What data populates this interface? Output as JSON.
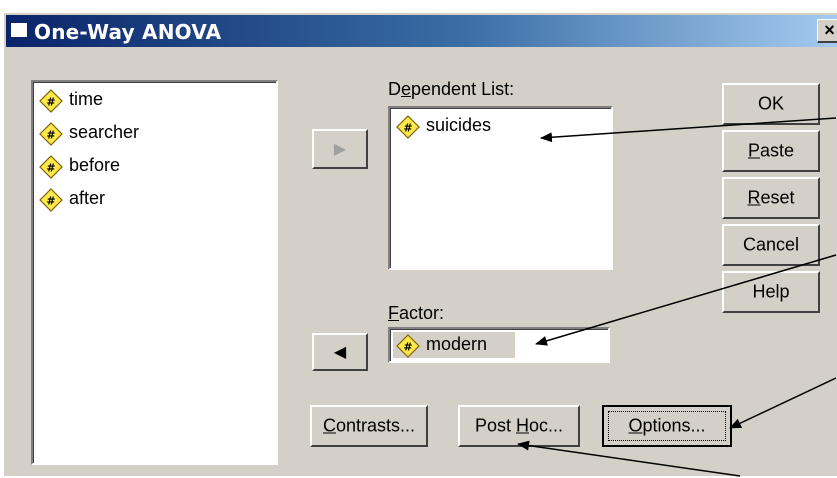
{
  "window": {
    "title": "One-Way ANOVA",
    "close_glyph": "×",
    "icon": "spss-dialog-icon"
  },
  "source_list": {
    "items": [
      {
        "label": "time",
        "icon": "scale-variable-icon"
      },
      {
        "label": "searcher",
        "icon": "scale-variable-icon"
      },
      {
        "label": "before",
        "icon": "scale-variable-icon"
      },
      {
        "label": "after",
        "icon": "scale-variable-icon"
      }
    ]
  },
  "dependent": {
    "label_prefix": "D",
    "label_underlined": "e",
    "label_suffix": "pendent List:",
    "items": [
      {
        "label": "suicides",
        "icon": "scale-variable-icon"
      }
    ]
  },
  "factor": {
    "label_underlined": "F",
    "label_suffix": "actor:",
    "value": "modern",
    "icon": "scale-variable-icon"
  },
  "transfer_buttons": {
    "dependent_arrow": "▶",
    "factor_arrow": "◀"
  },
  "side_buttons": {
    "ok": {
      "label": "OK"
    },
    "paste": {
      "underlined": "P",
      "rest": "aste"
    },
    "reset": {
      "underlined": "R",
      "rest": "eset"
    },
    "cancel": {
      "label": "Cancel"
    },
    "help": {
      "label": "Help"
    }
  },
  "bottom_buttons": {
    "contrasts": {
      "underlined": "C",
      "rest": "ontrasts..."
    },
    "posthoc": {
      "prefix": "Post ",
      "underlined": "H",
      "rest": "oc..."
    },
    "options": {
      "underlined": "O",
      "rest": "ptions..."
    }
  },
  "colors": {
    "titlebar_start": "#0a246a",
    "titlebar_end": "#a6caf0",
    "face": "#d4d0c8",
    "icon_fill": "#ffe94a"
  }
}
